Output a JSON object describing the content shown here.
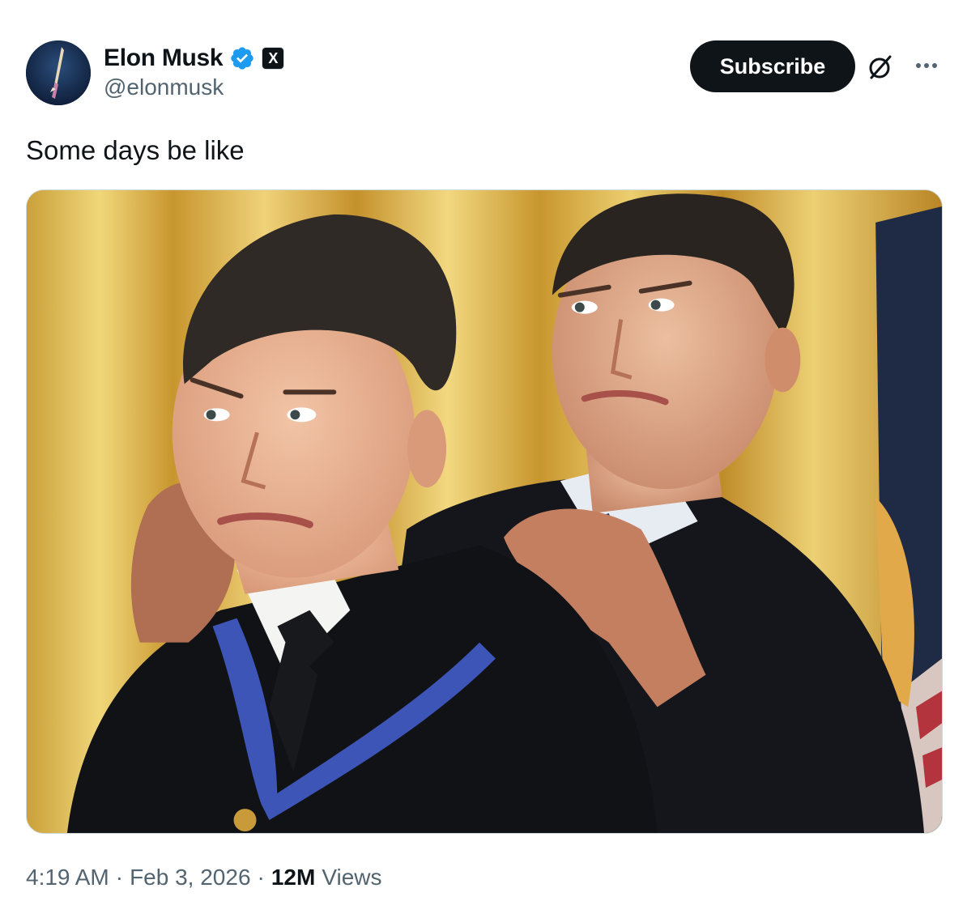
{
  "author": {
    "display_name": "Elon Musk",
    "handle": "@elonmusk",
    "verified_color": "#1d9bf0",
    "affiliate_badge": "X"
  },
  "actions": {
    "subscribe_label": "Subscribe",
    "grok_icon": "grok-icon",
    "more_icon": "more-icon"
  },
  "tweet": {
    "text": "Some days be like"
  },
  "meta": {
    "time": "4:19 AM",
    "sep1": "·",
    "date": "Feb 3, 2026",
    "sep2": "·",
    "views_count": "12M",
    "views_label": "Views"
  }
}
